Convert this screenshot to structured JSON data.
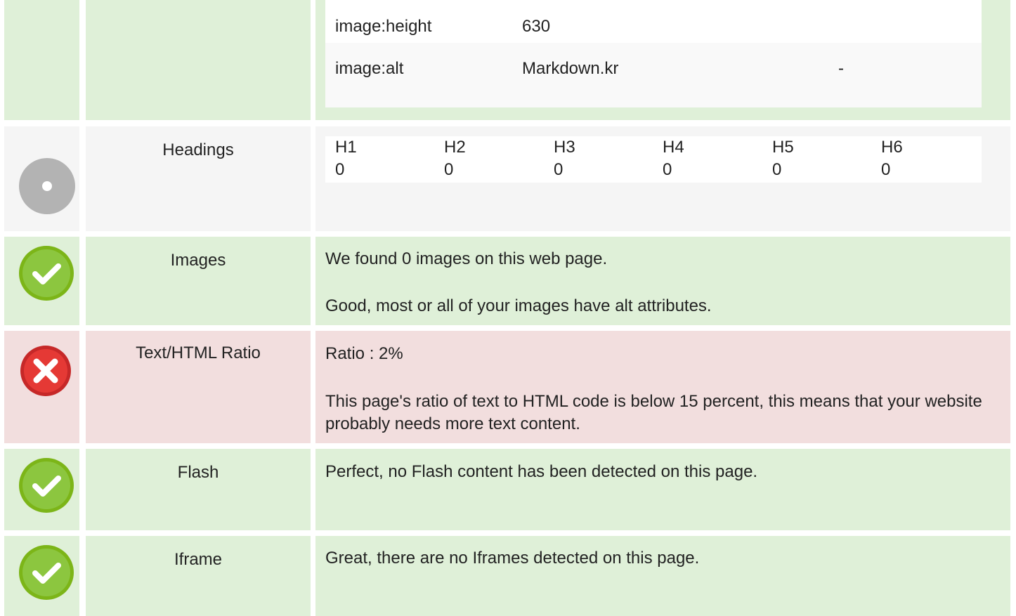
{
  "meta_rows": [
    {
      "key": "image:height",
      "value": "630",
      "extra": ""
    },
    {
      "key": "image:alt",
      "value": "Markdown.kr",
      "extra": "-"
    }
  ],
  "headings": {
    "label": "Headings",
    "status": "info",
    "levels": [
      {
        "name": "H1",
        "count": "0"
      },
      {
        "name": "H2",
        "count": "0"
      },
      {
        "name": "H3",
        "count": "0"
      },
      {
        "name": "H4",
        "count": "0"
      },
      {
        "name": "H5",
        "count": "0"
      },
      {
        "name": "H6",
        "count": "0"
      }
    ]
  },
  "images": {
    "label": "Images",
    "status": "pass",
    "line1": "We found 0 images on this web page.",
    "line2": "Good, most or all of your images have alt attributes."
  },
  "ratio": {
    "label": "Text/HTML Ratio",
    "status": "fail",
    "line1": "Ratio : 2%",
    "line2": "This page's ratio of text to HTML code is below 15 percent, this means that your website probably needs more text content."
  },
  "flash": {
    "label": "Flash",
    "status": "pass",
    "line1": "Perfect, no Flash content has been detected on this page."
  },
  "iframe": {
    "label": "Iframe",
    "status": "pass",
    "line1": "Great, there are no Iframes detected on this page."
  },
  "colors": {
    "pass_bg": "#dff0d8",
    "fail_bg": "#f2dede",
    "neutral_bg": "#f5f5f5",
    "pass_icon": "#8cc63f",
    "fail_icon": "#e53935",
    "info_icon": "#b3b3b3"
  },
  "icons": {
    "pass": "check-circle-icon",
    "fail": "x-circle-icon",
    "info": "dot-circle-icon"
  }
}
